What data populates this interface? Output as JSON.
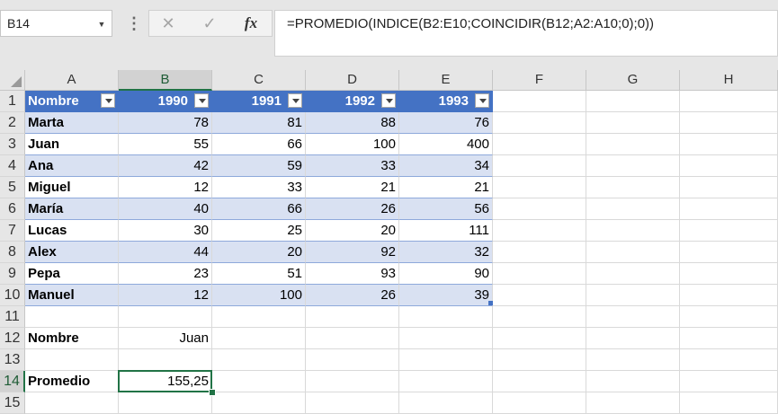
{
  "name_box": {
    "value": "B14"
  },
  "formula_bar": {
    "cancel_glyph": "✕",
    "enter_glyph": "✓",
    "fx_label": "fx",
    "formula": "=PROMEDIO(INDICE(B2:E10;COINCIDIR(B12;A2:A10;0);0))"
  },
  "columns": [
    "A",
    "B",
    "C",
    "D",
    "E",
    "F",
    "G",
    "H"
  ],
  "rows": [
    "1",
    "2",
    "3",
    "4",
    "5",
    "6",
    "7",
    "8",
    "9",
    "10",
    "11",
    "12",
    "13",
    "14",
    "15"
  ],
  "table": {
    "headers": [
      "Nombre",
      "1990",
      "1991",
      "1992",
      "1993"
    ],
    "rows": [
      {
        "name": "Marta",
        "values": [
          "78",
          "81",
          "88",
          "76"
        ]
      },
      {
        "name": "Juan",
        "values": [
          "55",
          "66",
          "100",
          "400"
        ]
      },
      {
        "name": "Ana",
        "values": [
          "42",
          "59",
          "33",
          "34"
        ]
      },
      {
        "name": "Miguel",
        "values": [
          "12",
          "33",
          "21",
          "21"
        ]
      },
      {
        "name": "María",
        "values": [
          "40",
          "66",
          "26",
          "56"
        ]
      },
      {
        "name": "Lucas",
        "values": [
          "30",
          "25",
          "20",
          "111"
        ]
      },
      {
        "name": "Alex",
        "values": [
          "44",
          "20",
          "92",
          "32"
        ]
      },
      {
        "name": "Pepa",
        "values": [
          "23",
          "51",
          "93",
          "90"
        ]
      },
      {
        "name": "Manuel",
        "values": [
          "12",
          "100",
          "26",
          "39"
        ]
      }
    ]
  },
  "lookup": {
    "label": "Nombre",
    "value": "Juan"
  },
  "result": {
    "label": "Promedio",
    "value": "155,25"
  },
  "colors": {
    "header_fill": "#4472c4",
    "band_fill": "#d9e1f2",
    "selection": "#217346"
  }
}
